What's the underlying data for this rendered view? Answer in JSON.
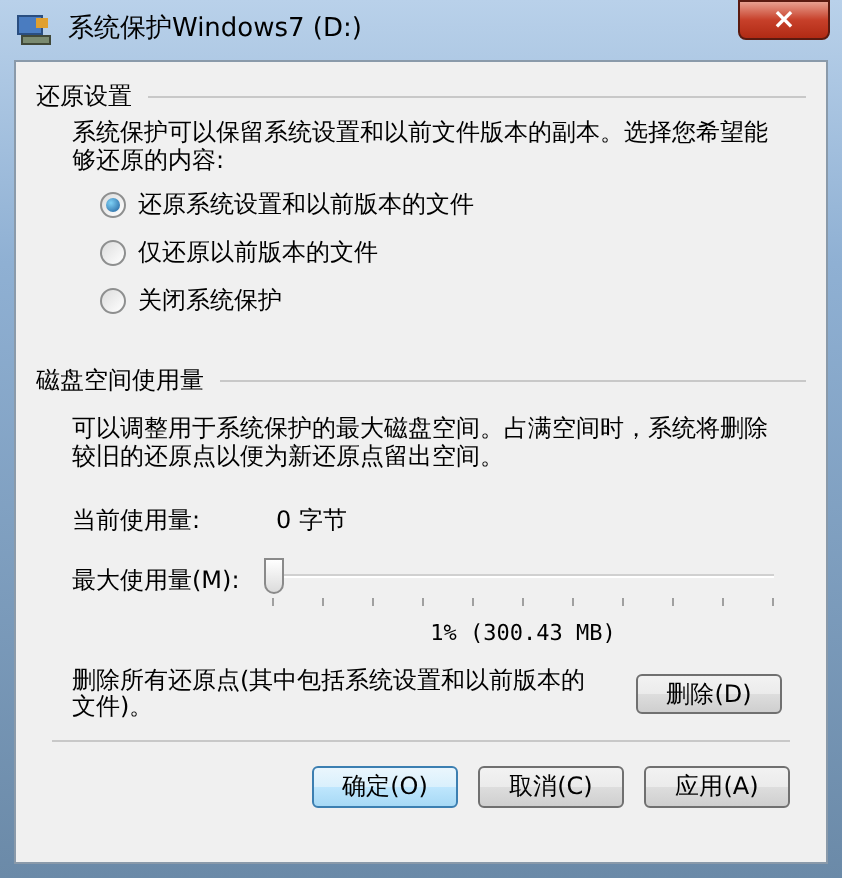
{
  "window": {
    "title": "系统保护Windows7 (D:)",
    "close": "×"
  },
  "restore_settings": {
    "heading": "还原设置",
    "description": "系统保护可以保留系统设置和以前文件版本的副本。选择您希望能够还原的内容:",
    "options": [
      {
        "label": "还原系统设置和以前版本的文件",
        "selected": true
      },
      {
        "label": "仅还原以前版本的文件",
        "selected": false
      },
      {
        "label": "关闭系统保护",
        "selected": false
      }
    ]
  },
  "disk_usage": {
    "heading": "磁盘空间使用量",
    "description": "可以调整用于系统保护的最大磁盘空间。占满空间时，系统将删除较旧的还原点以便为新还原点留出空间。",
    "current_label": "当前使用量:",
    "current_value": "0 字节",
    "max_label": "最大使用量(M):",
    "slider": {
      "level": 0.0
    },
    "slider_reading": "1% (300.43 MB)",
    "delete_text": "删除所有还原点(其中包括系统设置和以前版本的文件)。",
    "delete_button": "删除(D)"
  },
  "buttons": [
    {
      "label": "确定(O)",
      "default": true
    },
    {
      "label": "取消(C)",
      "default": false
    },
    {
      "label": "应用(A)",
      "default": false
    }
  ]
}
